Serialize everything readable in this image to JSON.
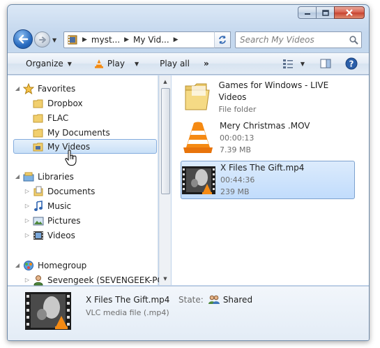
{
  "window": {
    "caption_buttons": [
      "minimize",
      "maximize",
      "close"
    ]
  },
  "address": {
    "segments": [
      "myst...",
      "My Vid..."
    ],
    "search_placeholder": "Search My Videos"
  },
  "toolbar": {
    "organize": "Organize",
    "play": "Play",
    "play_all": "Play all",
    "more": "»"
  },
  "nav": {
    "favorites": {
      "label": "Favorites",
      "items": [
        "Dropbox",
        "FLAC",
        "My Documents",
        "My Videos"
      ]
    },
    "libraries": {
      "label": "Libraries",
      "items": [
        "Documents",
        "Music",
        "Pictures",
        "Videos"
      ]
    },
    "homegroup": {
      "label": "Homegroup",
      "items": [
        "Sevengeek (SEVENGEEK-PC)"
      ]
    },
    "selected": "My Videos"
  },
  "files": [
    {
      "name": "Games for Windows - LIVE Videos",
      "line2": "File folder",
      "line3": "",
      "icon": "folder-icon"
    },
    {
      "name": "Mery Christmas .MOV",
      "line2": "00:00:13",
      "line3": "7.39 MB",
      "icon": "vlc-icon"
    },
    {
      "name": "X Files The Gift.mp4",
      "line2": "00:44:36",
      "line3": "239 MB",
      "icon": "video-thumbnail"
    }
  ],
  "details": {
    "name": "X Files The Gift.mp4",
    "type": "VLC media file (.mp4)",
    "state_label": "State:",
    "state_value": "Shared"
  },
  "colors": {
    "selection": "#c9e0f7",
    "toolbar": "#e3ebf5",
    "frame": "#c5d8ee"
  }
}
